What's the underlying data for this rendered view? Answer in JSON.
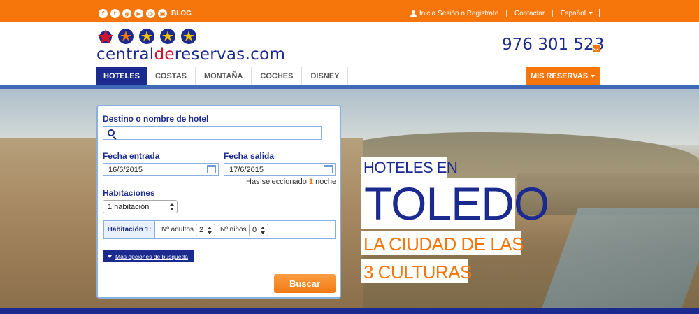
{
  "topbar": {
    "social_icons": [
      {
        "name": "facebook-icon",
        "glyph": "f"
      },
      {
        "name": "twitter-icon",
        "glyph": "t"
      },
      {
        "name": "google-plus-icon",
        "glyph": "g"
      },
      {
        "name": "youtube-icon",
        "glyph": "▶"
      },
      {
        "name": "instagram-icon",
        "glyph": "◎"
      },
      {
        "name": "blog-icon",
        "glyph": "▣"
      }
    ],
    "blog_label": "BLOG",
    "login_label": "Inicia Sesión o Registrate",
    "contact_label": "Contactar",
    "language_label": "Español",
    "separator": "|"
  },
  "header": {
    "logo_part1": "central",
    "logo_part2": "de",
    "logo_part3": "reservas.com",
    "phone": "976 301 523"
  },
  "nav": {
    "items": [
      {
        "label": "HOTELES",
        "active": true
      },
      {
        "label": "COSTAS",
        "active": false
      },
      {
        "label": "MONTAÑA",
        "active": false
      },
      {
        "label": "COCHES",
        "active": false
      },
      {
        "label": "DISNEY",
        "active": false
      }
    ],
    "my_bookings_label": "MIS RESERVAS"
  },
  "search": {
    "destination_label": "Destino o nombre de hotel",
    "destination_value": "",
    "checkin_label": "Fecha entrada",
    "checkin_value": "16/6/2015",
    "checkout_label": "Fecha salida",
    "checkout_value": "17/6/2015",
    "nights_prefix": "Has seleccionado",
    "nights_count": "1",
    "nights_suffix": "noche",
    "rooms_label": "Habitaciones",
    "rooms_value": "1 habitación",
    "room1_label": "Habitación 1:",
    "adults_label": "Nº adultos",
    "adults_value": "2",
    "children_label": "Nº niños",
    "children_value": "0",
    "more_options_label": "Más opciones de búsqueda",
    "search_button_label": "Buscar"
  },
  "promo": {
    "line1": "HOTELES EN",
    "line2": "TOLEDO",
    "line3": "LA CIUDAD DE LAS",
    "line4": "3 CULTURAS"
  },
  "colors": {
    "brand_blue": "#1b2a8f",
    "brand_orange": "#f7760b",
    "brand_red": "#d0132a"
  }
}
